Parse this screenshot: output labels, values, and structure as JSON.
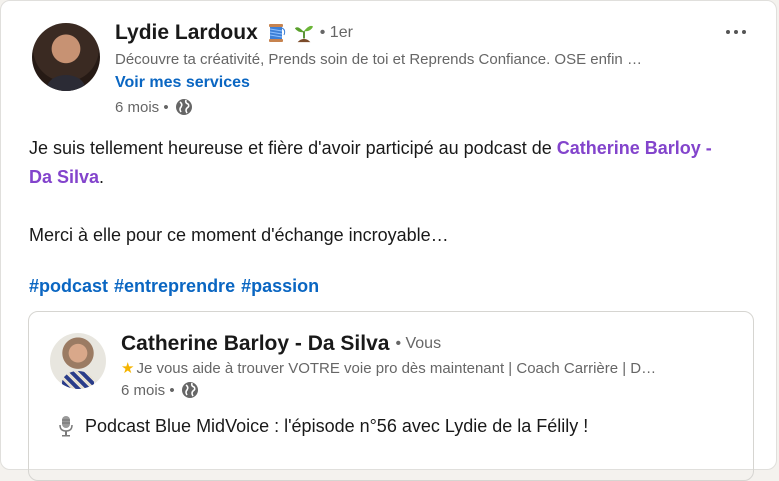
{
  "post": {
    "author": {
      "name": "Lydie Lardoux",
      "emoji_icons": [
        "spool-of-thread-icon",
        "seedling-icon"
      ],
      "degree": "• 1er",
      "headline": "Découvre ta créativité, Prends soin de toi et Reprends Confiance. OSE enfin …",
      "services_link": "Voir mes services",
      "time": "6 mois •",
      "visibility_icon": "globe-icon"
    },
    "body": {
      "line1_before": "Je suis tellement heureuse et fière d'avoir participé au podcast de ",
      "mention": "Catherine Barloy - Da Silva",
      "line1_after": ".",
      "line2": "Merci à elle pour ce moment d'échange incroyable…"
    },
    "hashtags": [
      "#podcast",
      "#entreprendre",
      "#passion"
    ],
    "menu_icon": "more-options-icon"
  },
  "shared_post": {
    "author": {
      "name": "Catherine Barloy - Da Silva",
      "relation": "• Vous",
      "headline_star_icon": "star-icon",
      "headline": "Je vous aide à trouver VOTRE voie pro dès maintenant | Coach Carrière | D…",
      "time": "6 mois •",
      "visibility_icon": "globe-icon"
    },
    "text": "Podcast Blue MidVoice : l'épisode n°56 avec Lydie de la Félily !",
    "text_icon": "microphone-icon"
  },
  "colors": {
    "link_blue": "#0a66c2",
    "mention_purple": "#8344cc",
    "meta_gray": "#666666",
    "star": "#f5b400"
  }
}
